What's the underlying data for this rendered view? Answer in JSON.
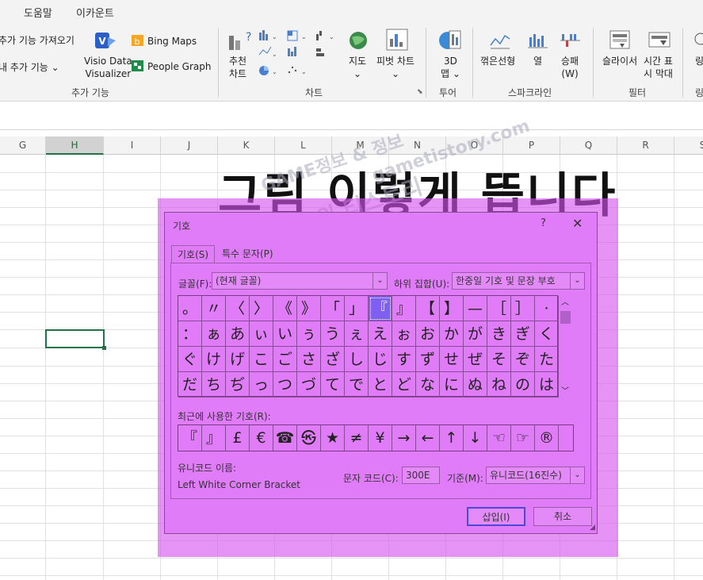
{
  "menu": {
    "help": "도움말",
    "account": "이카운트"
  },
  "ribbon": {
    "addins": {
      "get_addins": "추가 기능 가져오기",
      "my_addins": "내 추가 기능",
      "visio_l1": "Visio Data",
      "visio_l2": "Visualizer",
      "bing": "Bing Maps",
      "people": "People Graph",
      "label": "추가 기능"
    },
    "charts": {
      "rec_l1": "추천",
      "rec_l2": "차트",
      "maps": "지도",
      "pivot": "피벗 차트",
      "label": "차트"
    },
    "tours": {
      "map3d_l1": "3D",
      "map3d_l2": "맵",
      "label": "투어"
    },
    "sparklines": {
      "line": "꺾은선형",
      "col": "열",
      "wl_l1": "승패",
      "wl_l2": "(W)",
      "label": "스파크라인"
    },
    "filters": {
      "slicer": "슬라이서",
      "timeline_l1": "시간 표",
      "timeline_l2": "시 막대",
      "label": "필터"
    },
    "partial": "링"
  },
  "columns": [
    "G",
    "H",
    "I",
    "J",
    "K",
    "L",
    "M",
    "N",
    "O",
    "P",
    "Q",
    "R",
    "S"
  ],
  "overlay_text": "그림 이렇게 뜹니다",
  "watermark": {
    "w1": "GAME정보 & 정보",
    "w2": "식크의 티스토리",
    "w3": "gametistory.com"
  },
  "dialog": {
    "title": "기호",
    "help": "?",
    "close": "✕",
    "tab_symbols": "기호(S)",
    "tab_special": "특수 문자(P)",
    "font_label": "글꼴(F):",
    "font_value": "(현재 글꼴)",
    "subset_label": "하위 집합(U):",
    "subset_value": "한중일 기호 및 문장 부호",
    "symbols": [
      "。",
      "〃",
      "〈",
      "〉",
      "《",
      "》",
      "「",
      "」",
      "『",
      "』",
      "【",
      "】",
      "—",
      "［",
      "］",
      "·",
      "：",
      "ぁ",
      "あ",
      "ぃ",
      "い",
      "ぅ",
      "う",
      "ぇ",
      "え",
      "ぉ",
      "お",
      "か",
      "が",
      "き",
      "ぎ",
      "く",
      "ぐ",
      "け",
      "げ",
      "こ",
      "ご",
      "さ",
      "ざ",
      "し",
      "じ",
      "す",
      "ず",
      "せ",
      "ぜ",
      "そ",
      "ぞ",
      "た",
      "だ",
      "ち",
      "ぢ",
      "っ",
      "つ",
      "づ",
      "て",
      "で",
      "と",
      "ど",
      "な",
      "に",
      "ぬ",
      "ね",
      "の",
      "は"
    ],
    "selected_index": 8,
    "recent_label": "최근에 사용한 기호(R):",
    "recent": [
      "『",
      "』",
      "£",
      "€",
      "☎",
      "㉿",
      "★",
      "≠",
      "¥",
      "→",
      "←",
      "↑",
      "↓",
      "☜",
      "☞",
      "®"
    ],
    "unicode_name_label": "유니코드 이름:",
    "unicode_name": "Left White Corner Bracket",
    "char_code_label": "문자 코드(C):",
    "char_code": "300E",
    "from_label": "기준(M):",
    "from_value": "유니코드(16진수)",
    "insert": "삽입(I)",
    "cancel": "취소"
  }
}
